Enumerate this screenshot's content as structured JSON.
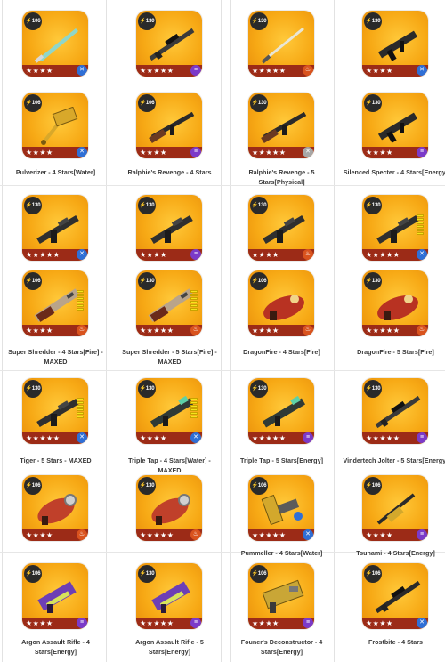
{
  "element_colors": {
    "physical": "#a7a7a7",
    "fire": "#d9531e",
    "energy": "#7b3ac9",
    "water": "#2f6fd6"
  },
  "items": [
    {
      "power": "106",
      "stars": "★★★★",
      "element": "water",
      "element_icon": "water-icon",
      "weapon": "sword",
      "color": "#8fd6c8",
      "name": ""
    },
    {
      "power": "130",
      "stars": "★★★★★",
      "element": "energy",
      "element_icon": "lightning-icon",
      "weapon": "sniper",
      "color": "#3a3a3a",
      "name": ""
    },
    {
      "power": "130",
      "stars": "★★★★★",
      "element": "fire",
      "element_icon": "flame-icon",
      "weapon": "katana",
      "color": "#d8d8c0",
      "name": ""
    },
    {
      "power": "130",
      "stars": "★★★★",
      "element": "water",
      "element_icon": "water-icon",
      "weapon": "smg",
      "color": "#2a2a2a",
      "name": ""
    },
    {
      "power": "106",
      "stars": "★★★★",
      "element": "water",
      "element_icon": "water-icon",
      "weapon": "hammer",
      "color": "#d8a82a",
      "name": "Pulverizer - 4 Stars[Water]"
    },
    {
      "power": "106",
      "stars": "★★★★",
      "element": "energy",
      "element_icon": "lightning-icon",
      "weapon": "rifle",
      "color": "#6a3a22",
      "name": "Ralphie's Revenge - 4 Stars"
    },
    {
      "power": "130",
      "stars": "★★★★★",
      "element": "physical",
      "element_icon": "claw-icon",
      "weapon": "rifle",
      "color": "#6a3a22",
      "name": "Ralphie's Revenge - 5 Stars[Physical]"
    },
    {
      "power": "130",
      "stars": "★★★★",
      "element": "energy",
      "element_icon": "energy-icon",
      "weapon": "smg",
      "color": "#2a2a2a",
      "name": "Silenced Specter - 4 Stars[Energy]"
    },
    {
      "power": "130",
      "stars": "★★★★★",
      "element": "water",
      "element_icon": "water-icon",
      "weapon": "assault",
      "color": "#2f2f2f",
      "name": ""
    },
    {
      "power": "130",
      "stars": "★★★★",
      "element": "energy",
      "element_icon": "lightning-icon",
      "weapon": "assault",
      "color": "#2f2f2f",
      "name": ""
    },
    {
      "power": "130",
      "stars": "★★★★",
      "element": "fire",
      "element_icon": "flame-icon",
      "weapon": "assault",
      "color": "#2f2f2f",
      "name": ""
    },
    {
      "power": "130",
      "stars": "★★★★★",
      "element": "water",
      "element_icon": "water-icon",
      "weapon": "assault",
      "color": "#2f2f2f",
      "name": "",
      "maxed": true
    },
    {
      "power": "106",
      "stars": "★★★★",
      "element": "fire",
      "element_icon": "flame-icon",
      "weapon": "shotgun",
      "color": "#b9a48a",
      "name": "Super Shredder - 4 Stars[Fire] - MAXED",
      "maxed": true
    },
    {
      "power": "130",
      "stars": "★★★★★",
      "element": "fire",
      "element_icon": "flame-icon",
      "weapon": "shotgun",
      "color": "#b9a48a",
      "name": "Super Shredder - 5 Stars[Fire] - MAXED",
      "maxed": true
    },
    {
      "power": "106",
      "stars": "★★★★",
      "element": "fire",
      "element_icon": "flame-icon",
      "weapon": "dragon",
      "color": "#b83222",
      "name": "DragonFire - 4 Stars[Fire]"
    },
    {
      "power": "130",
      "stars": "★★★★★",
      "element": "fire",
      "element_icon": "flame-icon",
      "weapon": "dragon",
      "color": "#b83222",
      "name": "DragonFire - 5 Stars[Fire]"
    },
    {
      "power": "130",
      "stars": "★★★★★",
      "element": "water",
      "element_icon": "water-icon",
      "weapon": "assault",
      "color": "#2f2f2f",
      "name": "Tiger - 5 Stars - MAXED",
      "maxed": true
    },
    {
      "power": "130",
      "stars": "★★★★",
      "element": "water",
      "element_icon": "water-icon",
      "weapon": "triple",
      "color": "#2f3a36",
      "name": "Triple Tap - 4 Stars[Water] - MAXED",
      "maxed": true
    },
    {
      "power": "130",
      "stars": "★★★★★",
      "element": "energy",
      "element_icon": "energy-icon",
      "weapon": "triple",
      "color": "#2f3a36",
      "name": "Triple Tap - 5 Stars[Energy]"
    },
    {
      "power": "130",
      "stars": "★★★★★",
      "element": "energy",
      "element_icon": "energy-icon",
      "weapon": "sniper",
      "color": "#3a3a3a",
      "name": "Vindertech Jolter - 5 Stars[Energy]"
    },
    {
      "power": "106",
      "stars": "★★★★",
      "element": "fire",
      "element_icon": "flame-icon",
      "weapon": "breath",
      "color": "#c0402a",
      "name": ""
    },
    {
      "power": "130",
      "stars": "★★★★★",
      "element": "fire",
      "element_icon": "flame-icon",
      "weapon": "breath",
      "color": "#c0402a",
      "name": ""
    },
    {
      "power": "106",
      "stars": "★★★★★",
      "element": "water",
      "element_icon": "water-icon",
      "weapon": "pummeller",
      "color": "#d3a82c",
      "name": "Pummeller - 4 Stars[Water]"
    },
    {
      "power": "106",
      "stars": "★★★★",
      "element": "energy",
      "element_icon": "energy-icon",
      "weapon": "tsunami",
      "color": "#2a2a2a",
      "name": "Tsunami - 4 Stars[Energy]"
    },
    {
      "power": "106",
      "stars": "★★★★",
      "element": "energy",
      "element_icon": "energy-icon",
      "weapon": "argon",
      "color": "#6d3fb5",
      "name": "Argon Assault Rifle - 4 Stars[Energy]"
    },
    {
      "power": "130",
      "stars": "★★★★★",
      "element": "energy",
      "element_icon": "energy-icon",
      "weapon": "argon",
      "color": "#6d3fb5",
      "name": "Argon Assault Rifle - 5 Stars[Energy]"
    },
    {
      "power": "106",
      "stars": "★★★★",
      "element": "energy",
      "element_icon": "energy-icon",
      "weapon": "deconstructor",
      "color": "#c9a636",
      "name": "Founer's Deconstructor - 4 Stars[Energy]"
    },
    {
      "power": "106",
      "stars": "★★★★",
      "element": "water",
      "element_icon": "water-icon",
      "weapon": "sniper",
      "color": "#2a2a2a",
      "name": "Frostbite - 4 Stars"
    }
  ]
}
